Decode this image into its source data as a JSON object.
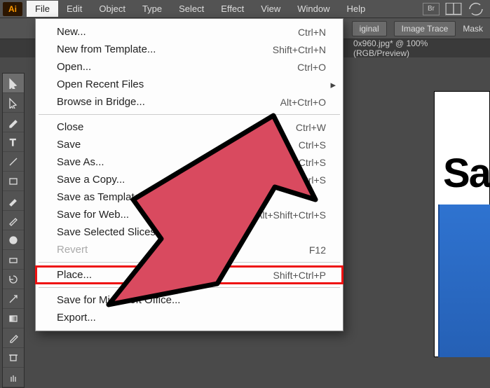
{
  "app": {
    "logo_text": "Ai"
  },
  "menubar": {
    "items": [
      "File",
      "Edit",
      "Object",
      "Type",
      "Select",
      "Effect",
      "View",
      "Window",
      "Help"
    ],
    "open_index": 0,
    "right_label": "Br"
  },
  "controlbar": {
    "btn1": "iginal",
    "btn2": "Image Trace",
    "btn3": "Mask"
  },
  "tabbar": {
    "doc_label": "0x960.jpg* @ 100% (RGB/Preview)"
  },
  "dropdown": {
    "groups": [
      [
        {
          "label": "New...",
          "shortcut": "Ctrl+N"
        },
        {
          "label": "New from Template...",
          "shortcut": "Shift+Ctrl+N"
        },
        {
          "label": "Open...",
          "shortcut": "Ctrl+O"
        },
        {
          "label": "Open Recent Files",
          "shortcut": "",
          "submenu": true
        },
        {
          "label": "Browse in Bridge...",
          "shortcut": "Alt+Ctrl+O"
        }
      ],
      [
        {
          "label": "Close",
          "shortcut": "Ctrl+W"
        },
        {
          "label": "Save",
          "shortcut": "Ctrl+S"
        },
        {
          "label": "Save As...",
          "shortcut": "Shift+Ctrl+S",
          "partial": true
        },
        {
          "label": "Save a Copy...",
          "shortcut": "Alt+Ctrl+S",
          "partial": true
        },
        {
          "label": "Save as Template...",
          "shortcut": "",
          "partial": true
        },
        {
          "label": "Save for Web...",
          "shortcut": "Alt+Shift+Ctrl+S",
          "partial": true
        },
        {
          "label": "Save Selected Slices...",
          "shortcut": "",
          "partial": true
        },
        {
          "label": "Revert",
          "shortcut": "F12",
          "disabled": true
        }
      ],
      [
        {
          "label": "Place...",
          "shortcut": "Shift+Ctrl+P",
          "highlight": true
        }
      ],
      [
        {
          "label": "Save for Microsoft Office...",
          "shortcut": ""
        },
        {
          "label": "Export...",
          "shortcut": ""
        }
      ]
    ]
  },
  "canvas": {
    "visible_text": "Sa"
  },
  "tools": [
    "selection",
    "direct-selection",
    "pen",
    "type",
    "line",
    "rectangle",
    "paintbrush",
    "pencil",
    "blob-brush",
    "eraser",
    "rotate",
    "scale",
    "gradient",
    "eyedropper",
    "artboard",
    "hand"
  ],
  "annotation": {
    "arrow_color": "#d94a5f",
    "arrow_outline": "#000000"
  }
}
